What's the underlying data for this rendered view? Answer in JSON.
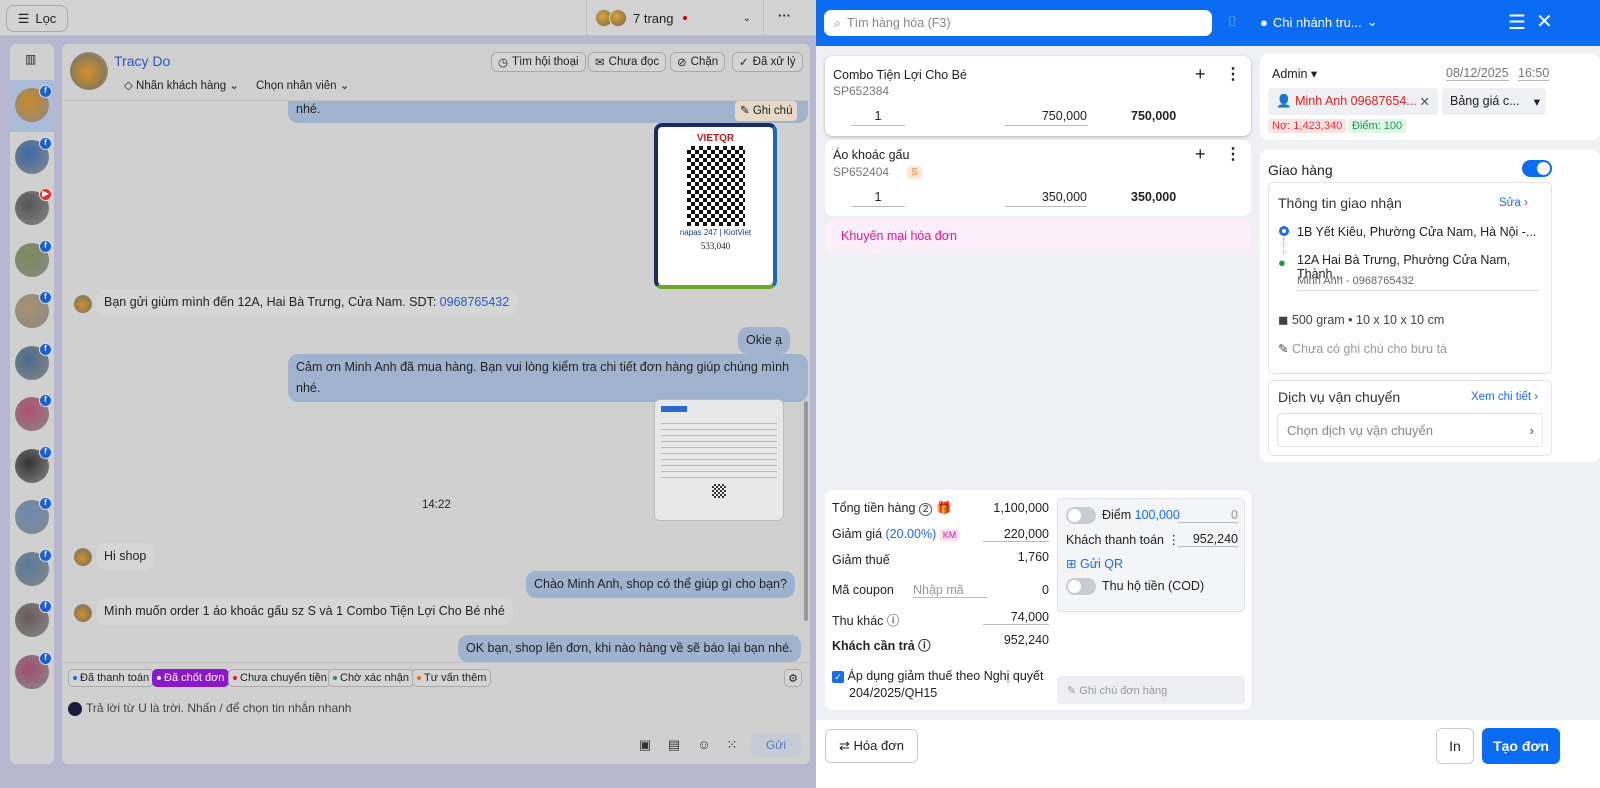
{
  "topbar": {
    "filter_label": "Lọc",
    "pages_label": "7 trang",
    "more": "···"
  },
  "chat": {
    "contact_name": "Tracy Do",
    "label_customer": "Nhãn khách hàng",
    "choose_staff": "Chọn nhân viên",
    "actions": [
      "Tìm hội thoại",
      "Chưa đọc",
      "Chặn",
      "Đã xử lý"
    ],
    "note_label": "Ghi chú",
    "messages": [
      {
        "from": "me",
        "text": "nhé."
      },
      {
        "from": "me",
        "type": "image",
        "qr_amount": "533,040",
        "qr_brand": "VIETQR"
      },
      {
        "from": "them",
        "text": "Bạn gửi giùm mình đến 12A, Hai Bà Trưng, Cửa Nam. SDT: ",
        "phone": "0968765432"
      },
      {
        "from": "me",
        "text": "Okie ạ"
      },
      {
        "from": "me",
        "text": "Cảm ơn Minh Anh đã mua hàng. Bạn vui lòng kiểm tra chi tiết đơn hàng giúp chúng mình",
        "text2": "nhé."
      },
      {
        "from": "me",
        "type": "invoice-image"
      },
      {
        "type": "time",
        "text": "14:22"
      },
      {
        "from": "them",
        "text": "Hi shop"
      },
      {
        "from": "me",
        "text": "Chào Minh Anh, shop có thể giúp gì cho bạn?"
      },
      {
        "from": "them",
        "text": "Mình muốn order 1 áo khoác gấu sz S và 1 Combo Tiện Lợi Cho Bé nhé"
      },
      {
        "from": "me",
        "text": "OK bạn, shop lên đơn, khi nào hàng về sẽ báo lại bạn nhé."
      }
    ],
    "tags": [
      {
        "label": "Đã thanh toán",
        "color": "#1a6cf0"
      },
      {
        "label": "Đã chốt đơn",
        "color": "#ffffff",
        "active": true
      },
      {
        "label": "Chưa chuyển tiền",
        "color": "#e02020"
      },
      {
        "label": "Chờ xác nhận",
        "color": "#1a9a50"
      },
      {
        "label": "Tư vấn thêm",
        "color": "#f06a10"
      }
    ],
    "reply_placeholder": "Trả lời từ U là trời. Nhấn / để chọn tin nhắn nhanh",
    "send_label": "Gửi"
  },
  "pos": {
    "search_placeholder": "Tìm hàng hóa (F3)",
    "branch": "Chi nhánh tru...",
    "products": [
      {
        "name": "Combo Tiện Lợi Cho Bé",
        "sku": "SP652384",
        "qty": "1",
        "price": "750,000",
        "total": "750,000"
      },
      {
        "name": "Áo khoác gấu",
        "sku": "SP652404",
        "variant": "S",
        "qty": "1",
        "price": "350,000",
        "total": "350,000"
      }
    ],
    "promo_label": "Khuyến mại hóa đơn",
    "summary": {
      "subtotal_label": "Tổng tiền hàng",
      "item_count": "2",
      "subtotal": "1,100,000",
      "discount_label": "Giảm giá",
      "discount_pct": "(20.00%)",
      "discount_badge": "KM",
      "discount": "220,000",
      "tax_label": "Giảm thuế",
      "tax": "1,760",
      "coupon_label": "Mã coupon",
      "coupon_placeholder": "Nhập mã",
      "coupon": "0",
      "other_label": "Thu khác",
      "other": "74,000",
      "due_label": "Khách cần trả",
      "due": "952,240",
      "tax_policy": "Áp dụng giảm thuế theo Nghị quyết",
      "tax_policy2": "204/2025/QH15"
    },
    "payment": {
      "points_label": "Điểm",
      "points": "100,000",
      "points_value": "0",
      "paid_label": "Khách thanh toán",
      "paid": "952,240",
      "send_qr": "Gửi QR",
      "cod_label": "Thu hộ tiền (COD)",
      "note_placeholder": "Ghi chú đơn hàng"
    },
    "order": {
      "seller": "Admin",
      "date": "08/12/2025",
      "time": "16:50",
      "customer": "Minh Anh 09687654...",
      "price_list": "Bảng giá c...",
      "debt": "Nợ: 1,423,340",
      "points": "Điểm: 100"
    },
    "delivery": {
      "title": "Giao hàng",
      "enabled": true,
      "info_title": "Thông tin giao nhận",
      "edit": "Sửa",
      "from": "1B Yết Kiêu, Phường Cửa Nam, Hà Nội -...",
      "to": "12A Hai Bà Trưng, Phường Cửa Nam, Thành...",
      "receiver": "Minh Anh - 0968765432",
      "package": "500 gram • 10 x 10 x 10 cm",
      "courier_note": "Chưa có ghi chú cho bưu tá",
      "service_title": "Dịch vụ vận chuyển",
      "service_detail": "Xem chi tiết",
      "service_placeholder": "Chọn dịch vụ vận chuyển"
    },
    "footer": {
      "switch_label": "Hóa đơn",
      "print": "In",
      "create": "Tạo đơn"
    }
  },
  "colors": {
    "accent": "#0a6cf2",
    "tag_active": "#8a18c8",
    "promo": "#e0189a"
  }
}
